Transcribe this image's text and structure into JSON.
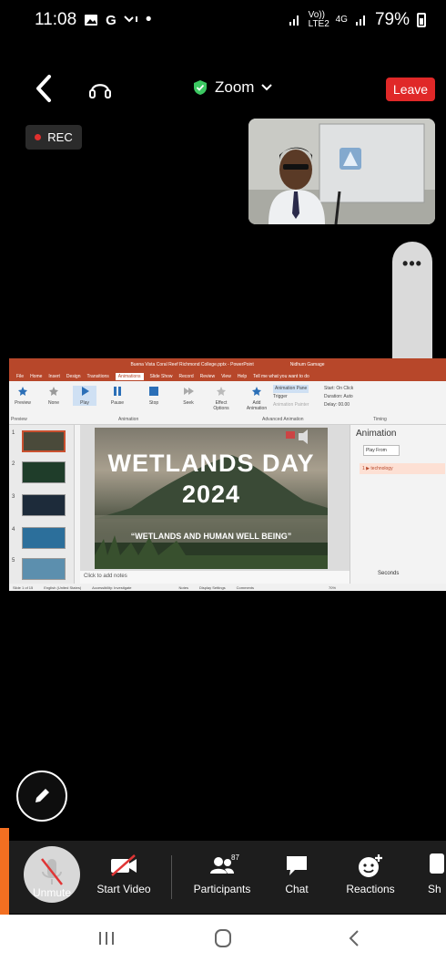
{
  "status_bar": {
    "time": "11:08",
    "app_icons": [
      "image-icon",
      "G",
      "missed-call-icon",
      "•"
    ],
    "network_left": "Vo)) LTE2",
    "network_right": "4G",
    "battery": "79%"
  },
  "topbar": {
    "meeting_name": "Zoom",
    "leave_label": "Leave"
  },
  "recording": {
    "label": "REC"
  },
  "side_panel": {
    "more_label": "•••"
  },
  "shared_screen": {
    "ppt_window_title": "Buena Vista Coral Reef Richmond College.pptx - PowerPoint",
    "ppt_user": "Nidhum Gamage",
    "ppt_tabs": [
      "File",
      "Home",
      "Insert",
      "Design",
      "Transitions",
      "Animations",
      "Slide Show",
      "Record",
      "Review",
      "View",
      "Help",
      "Tell me what you want to do"
    ],
    "ppt_active_tab": "Animations",
    "ribbon_items": [
      "Preview",
      "None",
      "Play",
      "Pause",
      "Stop",
      "Seek",
      "Effect Options",
      "Add Animation"
    ],
    "ribbon_side": [
      "Animation Pane",
      "Trigger",
      "Animation Painter"
    ],
    "timing": [
      "Start: On Click",
      "Duration: Auto",
      "Delay: 00.00"
    ],
    "groups": [
      "Preview",
      "Animation",
      "Advanced Animation",
      "Timing"
    ],
    "slide_numbers": [
      "1",
      "2",
      "3",
      "4",
      "5"
    ],
    "slide_title_line1": "WETLANDS DAY",
    "slide_title_line2": "2024",
    "slide_subtitle": "“WETLANDS AND HUMAN WELL BEING”",
    "notes_placeholder": "Click to add notes",
    "anim_pane_title": "Animation",
    "play_from": "Play From",
    "anim_item": "1 ▶ technology",
    "seconds_label": "Seconds",
    "status": [
      "Slide 1 of 15",
      "English (United States)",
      "Accessibility: Investigate",
      "Notes",
      "Display Settings",
      "Comments",
      "70%"
    ]
  },
  "toolbar": {
    "unmute_label": "Unmute",
    "start_video_label": "Start Video",
    "participants_label": "Participants",
    "participants_count": "87",
    "chat_label": "Chat",
    "reactions_label": "Reactions",
    "more_label": "Sh"
  },
  "colors": {
    "leave_red": "#e02828",
    "rec_red": "#e0302e",
    "shield_green": "#3cc862",
    "ppt_brand": "#b7472a",
    "toolbar_bg": "#1d1d1d",
    "accent_orange": "#f36f21"
  }
}
